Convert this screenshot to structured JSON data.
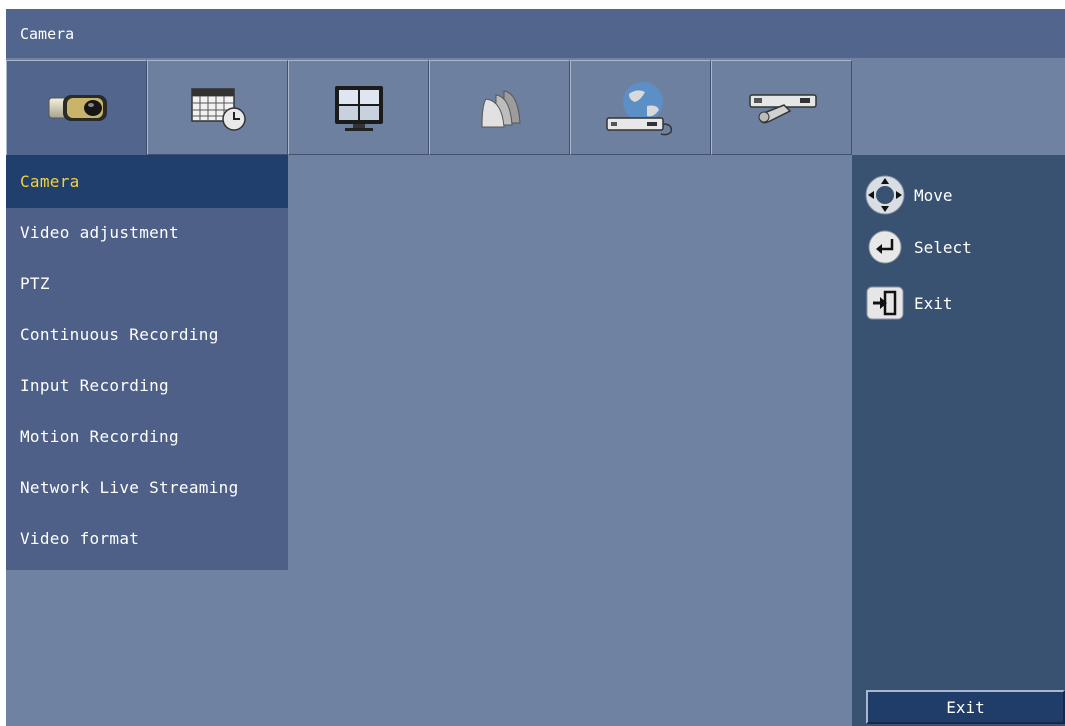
{
  "window": {
    "title": "Camera"
  },
  "tabs": [
    {
      "icon": "camera-icon",
      "active": true
    },
    {
      "icon": "schedule-calendar-icon",
      "active": false
    },
    {
      "icon": "monitor-icon",
      "active": false
    },
    {
      "icon": "events-stack-icon",
      "active": false
    },
    {
      "icon": "network-globe-icon",
      "active": false
    },
    {
      "icon": "system-tools-icon",
      "active": false
    }
  ],
  "menu": {
    "items": [
      {
        "label": "Camera",
        "active": true
      },
      {
        "label": "Video adjustment"
      },
      {
        "label": "PTZ"
      },
      {
        "label": "Continuous Recording"
      },
      {
        "label": "Input Recording"
      },
      {
        "label": "Motion Recording"
      },
      {
        "label": "Network Live Streaming"
      },
      {
        "label": "Video format"
      }
    ]
  },
  "hints": {
    "move": {
      "icon": "direction-pad-icon",
      "label": "Move"
    },
    "select": {
      "icon": "enter-key-icon",
      "label": "Select"
    },
    "exit": {
      "icon": "exit-door-icon",
      "label": "Exit"
    }
  },
  "footer": {
    "exit_label": "Exit"
  },
  "colors": {
    "background": "#6f82a2",
    "titlebar": "#52658d",
    "menu": "#4e6088",
    "selection": "#213f6d",
    "selection_text": "#f5d23c",
    "side_panel": "#3a5272"
  }
}
